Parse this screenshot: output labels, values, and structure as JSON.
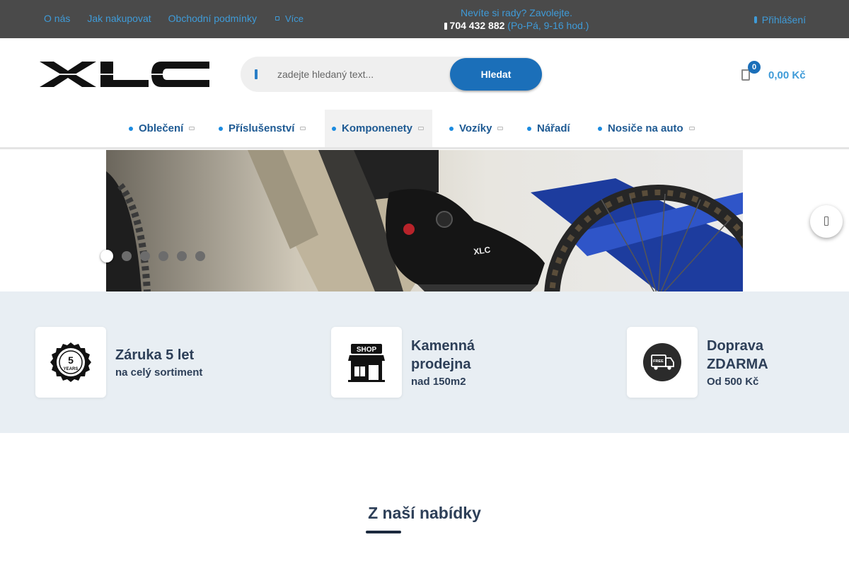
{
  "topbar": {
    "links": [
      "O nás",
      "Jak nakupovat",
      "Obchodní podmínky"
    ],
    "more_label": "Více",
    "contact_question": "Nevíte si rady? Zavolejte.",
    "phone": "704 432 882",
    "hours": "(Po-Pá, 9-16 hod.)",
    "login_label": "Přihlášení",
    "link_color": "#3f9bd8"
  },
  "header": {
    "logo_text": "XLC",
    "search_placeholder": "zadejte hledaný text...",
    "search_button": "Hledat",
    "cart_count": "0",
    "cart_total": "0,00 Kč",
    "accent_color": "#1b6fb9"
  },
  "nav": {
    "items": [
      {
        "label": "Oblečení",
        "has_submenu": true
      },
      {
        "label": "Příslušenství",
        "has_submenu": true
      },
      {
        "label": "Komponenety",
        "has_submenu": true,
        "active": true
      },
      {
        "label": "Vozíky",
        "has_submenu": true
      },
      {
        "label": "Nářadí",
        "has_submenu": false
      },
      {
        "label": "Nosiče na auto",
        "has_submenu": true
      }
    ]
  },
  "hero": {
    "slides": 6,
    "active_slide": 1,
    "shoe_logo_text": "XLC"
  },
  "benefits": [
    {
      "title": "Záruka 5 let",
      "subtitle": "na celý sortiment",
      "icon": "warranty-badge-icon",
      "badge_number": "5",
      "badge_text": "YEARS"
    },
    {
      "title": "Kamenná prodejna",
      "subtitle": "nad 150m2",
      "icon": "shop-icon",
      "badge_text": "SHOP"
    },
    {
      "title": "Doprava ZDARMA",
      "subtitle": "Od 500 Kč",
      "icon": "free-shipping-icon",
      "badge_text": "FREE"
    }
  ],
  "section": {
    "title": "Z naší nabídky"
  }
}
